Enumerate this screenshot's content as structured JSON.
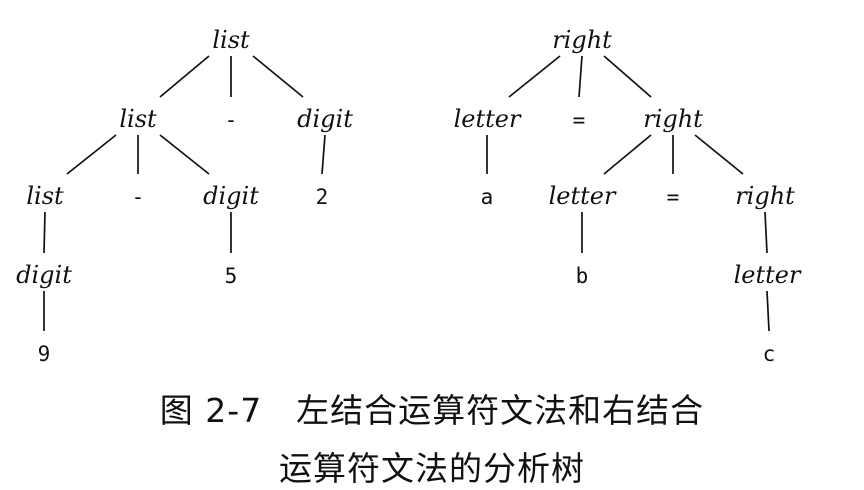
{
  "diagrams": [
    {
      "id": "left-assoc",
      "nodes": [
        {
          "id": "list1",
          "label": "list",
          "style": "italic"
        },
        {
          "id": "list2",
          "label": "list",
          "style": "italic"
        },
        {
          "id": "minus1",
          "label": "-",
          "style": "mono"
        },
        {
          "id": "digit1",
          "label": "digit",
          "style": "italic"
        },
        {
          "id": "list3",
          "label": "list",
          "style": "italic"
        },
        {
          "id": "minus2",
          "label": "-",
          "style": "mono"
        },
        {
          "id": "digit2",
          "label": "digit",
          "style": "italic"
        },
        {
          "id": "two",
          "label": "2",
          "style": "mono"
        },
        {
          "id": "digit3",
          "label": "digit",
          "style": "italic"
        },
        {
          "id": "five",
          "label": "5",
          "style": "mono"
        },
        {
          "id": "nine",
          "label": "9",
          "style": "mono"
        }
      ],
      "edges": [
        [
          "list1",
          "list2"
        ],
        [
          "list1",
          "minus1"
        ],
        [
          "list1",
          "digit1"
        ],
        [
          "list2",
          "list3"
        ],
        [
          "list2",
          "minus2"
        ],
        [
          "list2",
          "digit2"
        ],
        [
          "digit1",
          "two"
        ],
        [
          "list3",
          "digit3"
        ],
        [
          "digit2",
          "five"
        ],
        [
          "digit3",
          "nine"
        ]
      ]
    },
    {
      "id": "right-assoc",
      "nodes": [
        {
          "id": "right1",
          "label": "right",
          "style": "italic"
        },
        {
          "id": "letter1",
          "label": "letter",
          "style": "italic"
        },
        {
          "id": "eq1",
          "label": "=",
          "style": "mono"
        },
        {
          "id": "right2",
          "label": "right",
          "style": "italic"
        },
        {
          "id": "a",
          "label": "a",
          "style": "mono"
        },
        {
          "id": "letter2",
          "label": "letter",
          "style": "italic"
        },
        {
          "id": "eq2",
          "label": "=",
          "style": "mono"
        },
        {
          "id": "right3",
          "label": "right",
          "style": "italic"
        },
        {
          "id": "b",
          "label": "b",
          "style": "mono"
        },
        {
          "id": "letter3",
          "label": "letter",
          "style": "italic"
        },
        {
          "id": "c",
          "label": "c",
          "style": "mono"
        }
      ],
      "edges": [
        [
          "right1",
          "letter1"
        ],
        [
          "right1",
          "eq1"
        ],
        [
          "right1",
          "right2"
        ],
        [
          "letter1",
          "a"
        ],
        [
          "right2",
          "letter2"
        ],
        [
          "right2",
          "eq2"
        ],
        [
          "right2",
          "right3"
        ],
        [
          "letter2",
          "b"
        ],
        [
          "right3",
          "letter3"
        ],
        [
          "letter3",
          "c"
        ]
      ]
    }
  ],
  "caption": {
    "line1": "图 2-7　左结合运算符文法和右结合",
    "line2": "运算符文法的分析树"
  }
}
